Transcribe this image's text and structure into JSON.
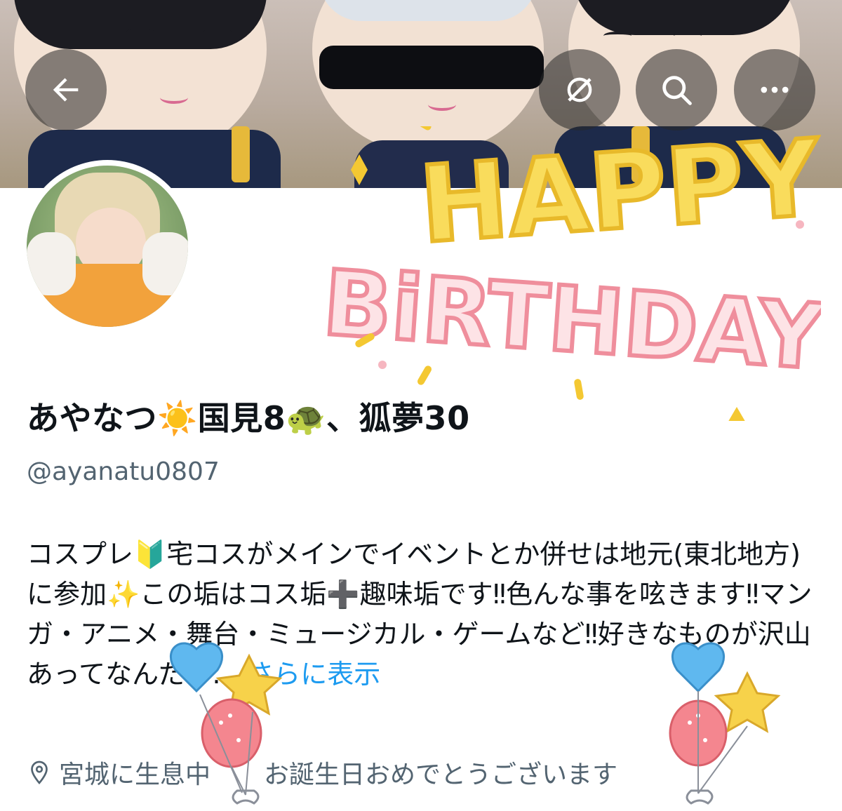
{
  "header": {
    "back_icon": "arrow-left-icon",
    "grok_icon": "grok-icon",
    "search_icon": "search-icon",
    "more_icon": "ellipsis-icon"
  },
  "profile": {
    "display_name": "あやなつ☀️国見8🐢、狐夢30",
    "handle": "@ayanatu0807",
    "bio_text": "コスプレ🔰宅コスがメインでイベントとか併せは地元(東北地方)に参加✨この垢はコス垢➕趣味垢です‼色んな事を呟きます‼マンガ・アニメ・舞台・ミュージカル・ゲームなど‼好きなものが沢山あってなんだか…",
    "bio_more": "さらに表示",
    "location": "宮城に生息中",
    "birthday_text": "お誕生日おめでとうございます"
  },
  "decoration": {
    "line1": "HAPPY",
    "line2": "BiRTHDAY"
  },
  "colors": {
    "accent": "#1d9bf0",
    "secondary_text": "#536471",
    "primary_text": "#0f1419",
    "happy_yellow": "#f7d24a",
    "birthday_pink": "#f29aa8"
  }
}
